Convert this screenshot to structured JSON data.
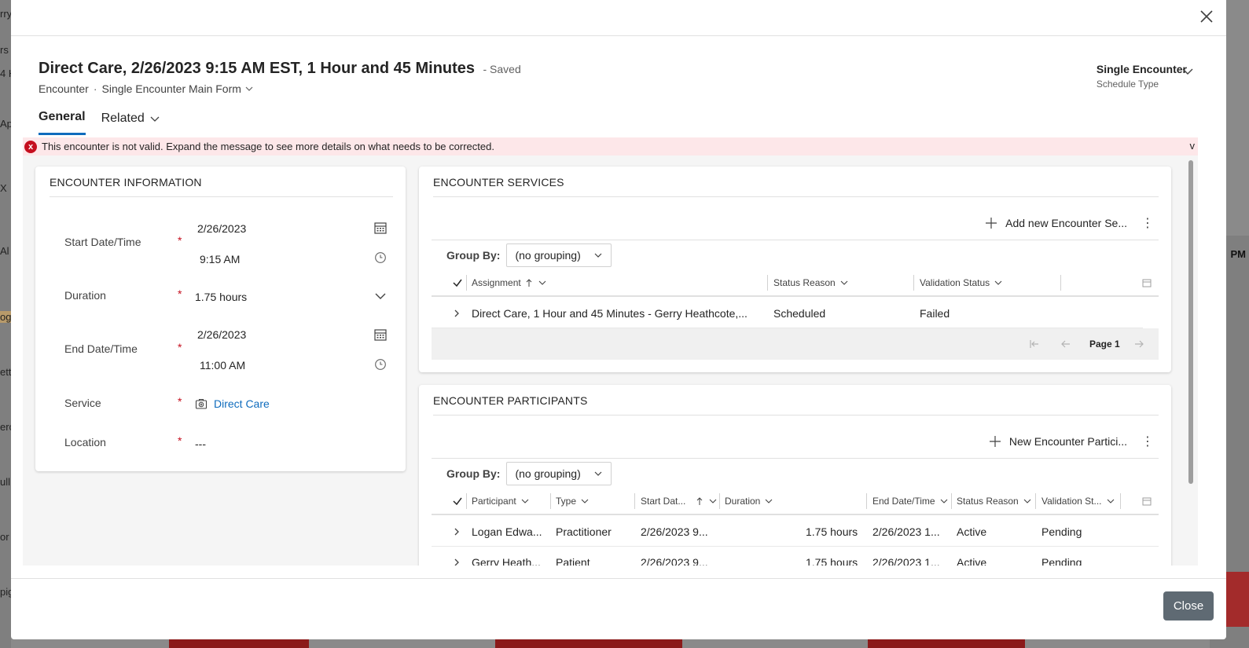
{
  "background": {
    "fragments": [
      "rry",
      "rs",
      "4 H",
      "Ap",
      "X",
      "Al",
      "og",
      "ett",
      "erc",
      "ull",
      "or",
      "pig"
    ],
    "right_label": "PM"
  },
  "header": {
    "title": "Direct Care, 2/26/2023 9:15 AM EST, 1 Hour and 45 Minutes",
    "saved_status": "- Saved",
    "entity": "Encounter",
    "separator": "·",
    "form_name": "Single Encounter Main Form",
    "schedule_type_value": "Single Encounter",
    "schedule_type_label": "Schedule Type"
  },
  "tabs": [
    {
      "label": "General"
    },
    {
      "label": "Related"
    }
  ],
  "alert": {
    "message": "This encounter is not valid. Expand the message to see more details on what needs to be corrected.",
    "expand": "v",
    "icon": "x"
  },
  "encounter_info": {
    "title": "ENCOUNTER INFORMATION",
    "required_mark": "*",
    "start_label": "Start Date/Time",
    "start_date": "2/26/2023",
    "start_time": "9:15 AM",
    "duration_label": "Duration",
    "duration_value": "1.75 hours",
    "end_label": "End Date/Time",
    "end_date": "2/26/2023",
    "end_time": "11:00 AM",
    "service_label": "Service",
    "service_value": "Direct Care",
    "location_label": "Location",
    "location_value": "---"
  },
  "services": {
    "title": "ENCOUNTER SERVICES",
    "add_label": "Add new Encounter Se...",
    "group_by_label": "Group By:",
    "group_by_value": "(no grouping)",
    "columns": [
      "Assignment",
      "Status Reason",
      "Validation Status"
    ],
    "rows": [
      {
        "assignment": "Direct Care, 1 Hour and 45 Minutes - Gerry Heathcote,...",
        "status": "Scheduled",
        "validation": "Failed"
      }
    ],
    "page_label": "Page 1"
  },
  "participants": {
    "title": "ENCOUNTER PARTICIPANTS",
    "add_label": "New Encounter Partici...",
    "group_by_label": "Group By:",
    "group_by_value": "(no grouping)",
    "columns": [
      "Participant",
      "Type",
      "Start Dat...",
      "Duration",
      "End Date/Time",
      "Status Reason",
      "Validation St..."
    ],
    "rows": [
      {
        "participant": "Logan Edwa...",
        "type": "Practitioner",
        "start": "2/26/2023 9...",
        "duration": "1.75 hours",
        "end": "2/26/2023 1...",
        "status": "Active",
        "validation": "Pending"
      },
      {
        "participant": "Gerry Heath...",
        "type": "Patient",
        "start": "2/26/2023 9...",
        "duration": "1.75 hours",
        "end": "2/26/2023 1...",
        "status": "Active",
        "validation": "Pending"
      }
    ]
  },
  "footer": {
    "close_label": "Close"
  },
  "colors": {
    "accent": "#0f6cbd",
    "error": "#c50f1f",
    "alert_bg": "#fde7e9",
    "close_button": "#5f6a73"
  }
}
